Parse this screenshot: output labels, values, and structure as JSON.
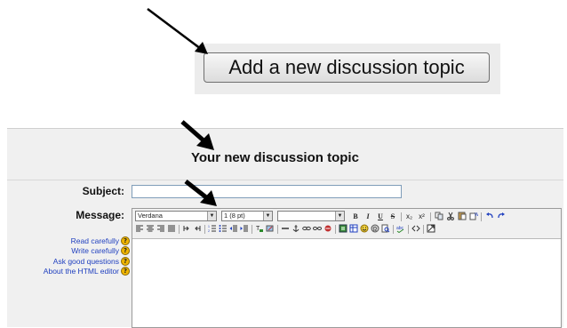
{
  "add_button": {
    "label": "Add a new discussion topic"
  },
  "form": {
    "heading": "Your new discussion topic",
    "subject_label": "Subject:",
    "message_label": "Message:",
    "subject_value": ""
  },
  "editor": {
    "font_family": "Verdana",
    "font_size": "1 (8 pt)",
    "paragraph_format": "",
    "format_buttons": [
      "B",
      "I",
      "U",
      "S"
    ],
    "subscript": "x₂",
    "superscript": "x²"
  },
  "help_links": [
    {
      "label": "Read carefully"
    },
    {
      "label": "Write carefully"
    },
    {
      "label": "Ask good questions"
    },
    {
      "label": "About the HTML editor"
    }
  ],
  "colors": {
    "link": "#1f3fbf",
    "help_icon": "#f0b500",
    "panel_bg": "#f0f0f0"
  }
}
